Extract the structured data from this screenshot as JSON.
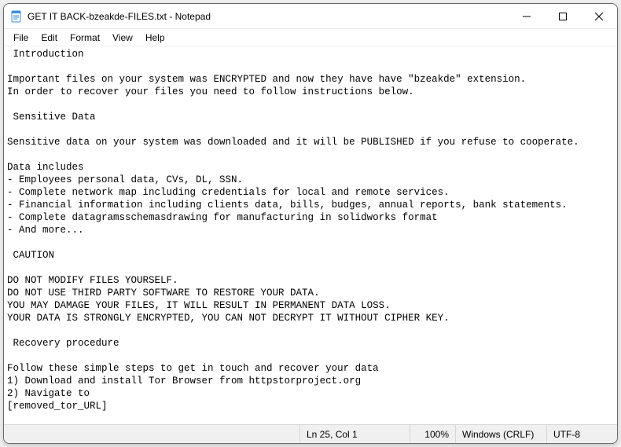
{
  "window": {
    "title": "GET IT BACK-bzeakde-FILES.txt - Notepad"
  },
  "menubar": {
    "items": [
      "File",
      "Edit",
      "Format",
      "View",
      "Help"
    ]
  },
  "editor": {
    "text": " Introduction\n\nImportant files on your system was ENCRYPTED and now they have have \"bzeakde\" extension.\nIn order to recover your files you need to follow instructions below.\n\n Sensitive Data\n\nSensitive data on your system was downloaded and it will be PUBLISHED if you refuse to cooperate.\n\nData includes\n- Employees personal data, CVs, DL, SSN.\n- Complete network map including credentials for local and remote services.\n- Financial information including clients data, bills, budges, annual reports, bank statements.\n- Complete datagramsschemasdrawing for manufacturing in solidworks format\n- And more...\n\n CAUTION\n\nDO NOT MODIFY FILES YOURSELF.\nDO NOT USE THIRD PARTY SOFTWARE TO RESTORE YOUR DATA.\nYOU MAY DAMAGE YOUR FILES, IT WILL RESULT IN PERMANENT DATA LOSS.\nYOUR DATA IS STRONGLY ENCRYPTED, YOU CAN NOT DECRYPT IT WITHOUT CIPHER KEY.\n\n Recovery procedure\n\nFollow these simple steps to get in touch and recover your data\n1) Download and install Tor Browser from httpstorproject.org\n2) Navigate to\n[removed_tor_URL]"
  },
  "statusbar": {
    "position": "Ln 25, Col 1",
    "zoom": "100%",
    "eol": "Windows (CRLF)",
    "encoding": "UTF-8"
  }
}
